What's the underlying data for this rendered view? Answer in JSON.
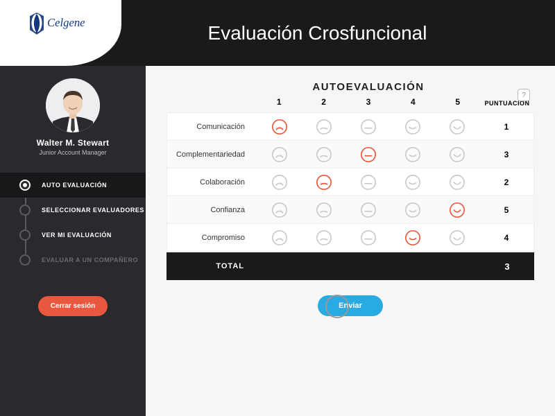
{
  "brand": {
    "name": "Celgene",
    "primary_color": "#14387f"
  },
  "header": {
    "title": "Evaluación Crosfuncional"
  },
  "user": {
    "name": "Walter M. Stewart",
    "role": "Junior Account Manager"
  },
  "nav": {
    "items": [
      {
        "label": "AUTO EVALUACIÓN",
        "state": "current"
      },
      {
        "label": "SELECCIONAR EVALUADORES",
        "state": "normal"
      },
      {
        "label": "VER MI EVALUACIÓN",
        "state": "normal"
      },
      {
        "label": "EVALUAR A UN COMPAÑERO",
        "state": "disabled"
      }
    ],
    "logout_label": "Cerrar sesión"
  },
  "table": {
    "title": "AUTOEVALUACIÓN",
    "score_header": "PUNTUACIÓN",
    "levels": [
      "1",
      "2",
      "3",
      "4",
      "5"
    ],
    "rows": [
      {
        "label": "Comunicación",
        "selected": 1,
        "score": "1"
      },
      {
        "label": "Complementariedad",
        "selected": 3,
        "score": "3"
      },
      {
        "label": "Colaboración",
        "selected": 2,
        "score": "2"
      },
      {
        "label": "Confianza",
        "selected": 5,
        "score": "5"
      },
      {
        "label": "Compromiso",
        "selected": 4,
        "score": "4"
      }
    ],
    "total_label": "TOTAL",
    "total_value": "3"
  },
  "actions": {
    "submit_label": "Enviar"
  },
  "colors": {
    "selected": "#e9573f",
    "unselected": "#c9c9c9",
    "accent": "#29abe2"
  },
  "help": {
    "label": "?"
  }
}
